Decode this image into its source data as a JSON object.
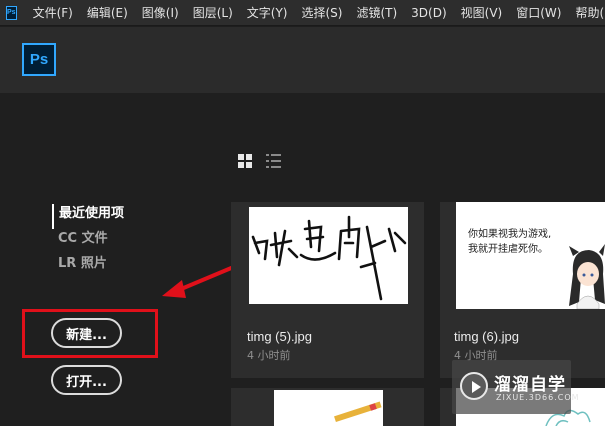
{
  "menubar": {
    "logo": "Ps",
    "items": [
      "文件(F)",
      "编辑(E)",
      "图像(I)",
      "图层(L)",
      "文字(Y)",
      "选择(S)",
      "滤镜(T)",
      "3D(D)",
      "视图(V)",
      "窗口(W)",
      "帮助(H)"
    ]
  },
  "header": {
    "logo": "Ps"
  },
  "sidebar": {
    "items": [
      {
        "label": "最近使用项"
      },
      {
        "label": "CC 文件"
      },
      {
        "label": "LR 照片"
      }
    ],
    "new_label": "新建...",
    "open_label": "打开..."
  },
  "recent_files": [
    {
      "name": "timg (5).jpg",
      "time": "4 小时前"
    },
    {
      "name": "timg (6).jpg",
      "time": "4 小时前"
    }
  ],
  "thumb_cartoon": {
    "line1": "你如果视我为游戏,",
    "line2": "我就开挂虐死你。"
  },
  "watermark": {
    "title": "溜溜自学",
    "subtitle": "ZIXUE.3D66.COM"
  },
  "colors": {
    "accent": "#31a8ff",
    "annotation": "#e0101a"
  }
}
